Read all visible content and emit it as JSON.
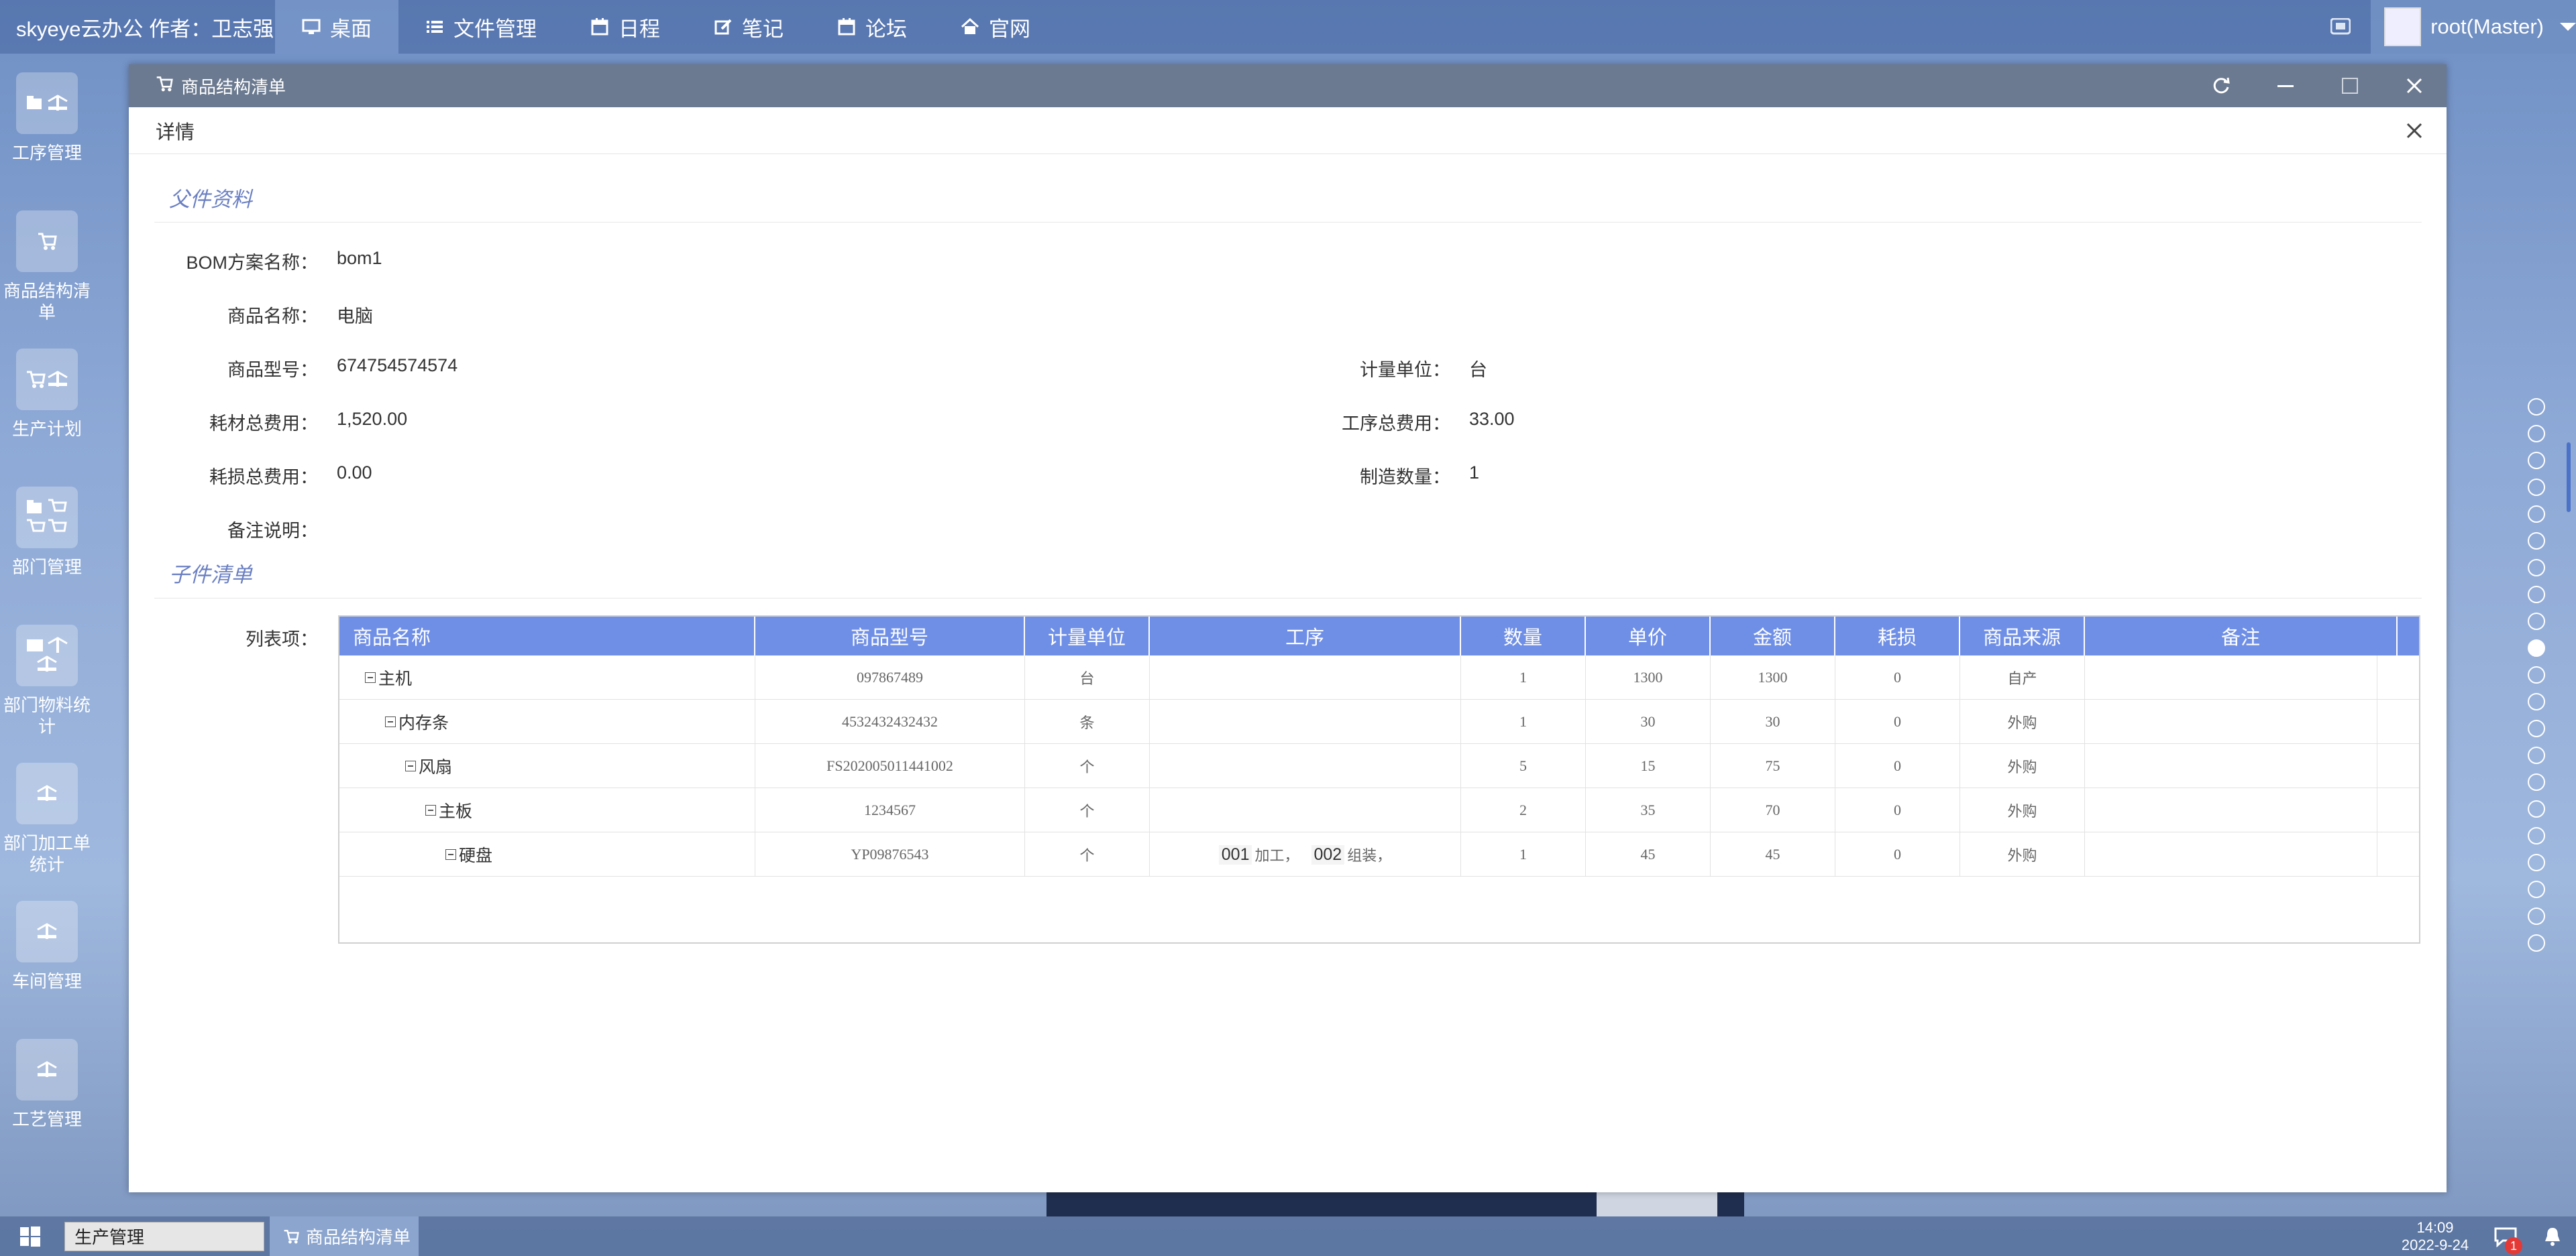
{
  "topbar": {
    "brand": "skyeye云办公 作者：卫志强",
    "nav": [
      {
        "label": "桌面",
        "icon": "monitor-icon",
        "active": true
      },
      {
        "label": "文件管理",
        "icon": "list-icon"
      },
      {
        "label": "日程",
        "icon": "calendar-icon"
      },
      {
        "label": "笔记",
        "icon": "edit-icon"
      },
      {
        "label": "论坛",
        "icon": "calendar-icon"
      },
      {
        "label": "官网",
        "icon": "home-icon"
      }
    ],
    "user": "root(Master)"
  },
  "desktop_icons": [
    {
      "label": "工序管理"
    },
    {
      "label": "商品结构清单"
    },
    {
      "label": "生产计划"
    },
    {
      "label": "部门管理"
    },
    {
      "label": "部门物料统计"
    },
    {
      "label": "部门加工单统计"
    },
    {
      "label": "车间管理"
    },
    {
      "label": "工艺管理"
    }
  ],
  "window": {
    "title": "商品结构清单",
    "detail_title": "详情",
    "parent_section": "父件资料",
    "child_section": "子件清单",
    "fields": {
      "bom_name_label": "BOM方案名称：",
      "bom_name": "bom1",
      "product_name_label": "商品名称：",
      "product_name": "电脑",
      "model_label": "商品型号：",
      "model": "674754574574",
      "unit_label": "计量单位：",
      "unit": "台",
      "material_cost_label": "耗材总费用：",
      "material_cost": "1,520.00",
      "process_cost_label": "工序总费用：",
      "process_cost": "33.00",
      "loss_cost_label": "耗损总费用：",
      "loss_cost": "0.00",
      "make_qty_label": "制造数量：",
      "make_qty": "1",
      "remark_label": "备注说明：",
      "list_label": "列表项："
    },
    "table": {
      "headers": [
        "商品名称",
        "商品型号",
        "计量单位",
        "工序",
        "数量",
        "单价",
        "金额",
        "耗损",
        "商品来源",
        "备注"
      ],
      "rows": [
        {
          "name": "主机",
          "depth": 0,
          "model": "097867489",
          "unit": "台",
          "process": "",
          "qty": "1",
          "price": "1300",
          "amount": "1300",
          "loss": "0",
          "source": "自产",
          "remark": ""
        },
        {
          "name": "内存条",
          "depth": 1,
          "model": "4532432432432",
          "unit": "条",
          "process": "",
          "qty": "1",
          "price": "30",
          "amount": "30",
          "loss": "0",
          "source": "外购",
          "remark": ""
        },
        {
          "name": "风扇",
          "depth": 2,
          "model": "FS202005011441002",
          "unit": "个",
          "process": "",
          "qty": "5",
          "price": "15",
          "amount": "75",
          "loss": "0",
          "source": "外购",
          "remark": ""
        },
        {
          "name": "主板",
          "depth": 3,
          "model": "1234567",
          "unit": "个",
          "process": "",
          "qty": "2",
          "price": "35",
          "amount": "70",
          "loss": "0",
          "source": "外购",
          "remark": ""
        },
        {
          "name": "硬盘",
          "depth": 4,
          "model": "YP09876543",
          "unit": "个",
          "process": "",
          "proc1_code": "001",
          "proc1_name": "加工，",
          "proc2_code": "002",
          "proc2_name": "组装，",
          "qty": "1",
          "price": "45",
          "amount": "45",
          "loss": "0",
          "source": "外购",
          "remark": ""
        }
      ]
    }
  },
  "pager": {
    "dot_count": 21,
    "active_index": 9
  },
  "taskbar": {
    "search_text": "生产管理",
    "task_label": "商品结构清单",
    "time": "14:09",
    "date": "2022-9-24",
    "notification_count": "1"
  },
  "colors": {
    "table_header": "#6f8fe6",
    "section_title": "#6a7fc2",
    "window_title": "#6b7a90"
  }
}
